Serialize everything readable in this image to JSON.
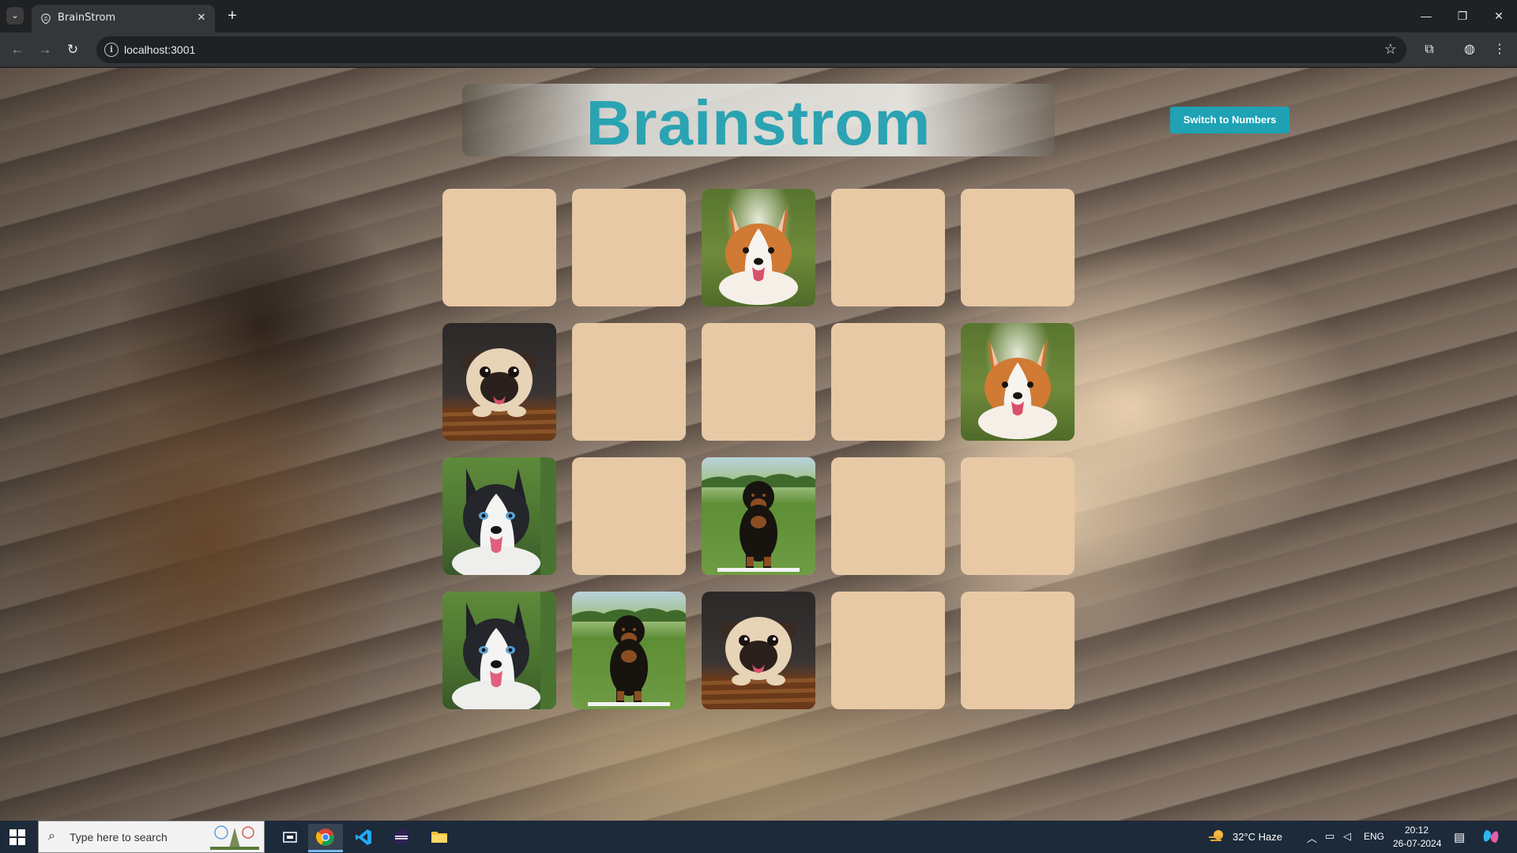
{
  "browser": {
    "tab_title": "BrainStrom",
    "tab_close": "✕",
    "new_tab": "+",
    "url": "localhost:3001"
  },
  "page": {
    "title": "Brainstrom",
    "switch_button": "Switch to Numbers"
  },
  "cards": [
    {
      "state": "hidden"
    },
    {
      "state": "hidden"
    },
    {
      "state": "revealed",
      "dog": "corgi"
    },
    {
      "state": "hidden"
    },
    {
      "state": "hidden"
    },
    {
      "state": "revealed",
      "dog": "pug"
    },
    {
      "state": "hidden"
    },
    {
      "state": "hidden"
    },
    {
      "state": "hidden"
    },
    {
      "state": "revealed",
      "dog": "corgi"
    },
    {
      "state": "revealed",
      "dog": "husky"
    },
    {
      "state": "hidden"
    },
    {
      "state": "revealed",
      "dog": "rottweiler"
    },
    {
      "state": "hidden"
    },
    {
      "state": "hidden"
    },
    {
      "state": "revealed",
      "dog": "husky"
    },
    {
      "state": "revealed",
      "dog": "rottweiler"
    },
    {
      "state": "revealed",
      "dog": "pug"
    },
    {
      "state": "hidden"
    },
    {
      "state": "hidden"
    }
  ],
  "colors": {
    "card_back": "#e8c9a5",
    "title_accent": "#2aa3b3",
    "button_bg": "#1ea2b4"
  },
  "taskbar": {
    "search_placeholder": "Type here to search",
    "weather": "32°C  Haze",
    "language": "ENG",
    "time": "20:12",
    "date": "26-07-2024"
  }
}
